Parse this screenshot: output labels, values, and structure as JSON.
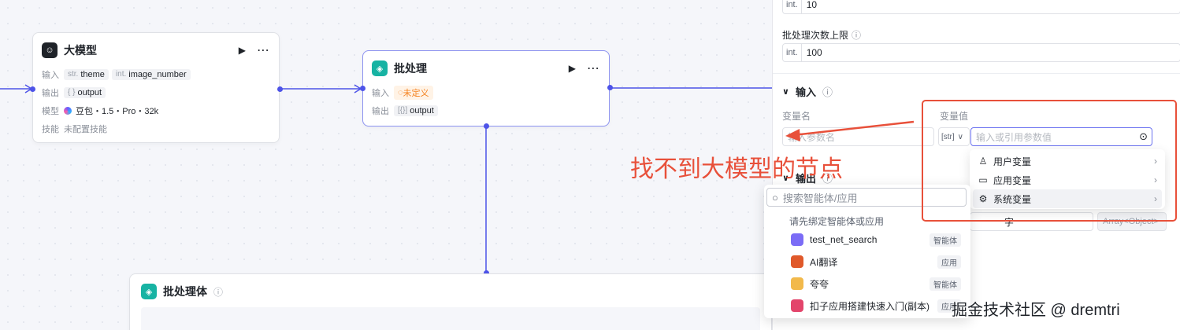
{
  "canvas": {
    "node_llm": {
      "title": "大模型",
      "input_label": "输入",
      "inputs": [
        {
          "type": "str.",
          "name": "theme"
        },
        {
          "type": "int.",
          "name": "image_number"
        }
      ],
      "output_label": "输出",
      "output": {
        "type": "{ }",
        "name": "output"
      },
      "model_label": "模型",
      "model_value": "豆包・1.5・Pro・32k",
      "skill_label": "技能",
      "skill_value": "未配置技能"
    },
    "node_batch": {
      "title": "批处理",
      "input_label": "输入",
      "input_value": "未定义",
      "output_label": "输出",
      "output": {
        "type": "[{}]",
        "name": "output"
      }
    },
    "node_batch_body": {
      "title": "批处理体"
    }
  },
  "panel": {
    "int_prefix": "int.",
    "concurrency_value": "10",
    "max_batch_label": "批处理次数上限",
    "max_batch_value": "100",
    "input_section_title": "输入",
    "var_name_header": "变量名",
    "var_value_header": "变量值",
    "var_name_placeholder": "输入参数名",
    "type_select_value": "[str]",
    "var_value_placeholder": "输入或引用参数值",
    "output_section_title": "输出",
    "hidden_field_fragment": "字",
    "hidden_type_fragment": "Array<Object>"
  },
  "variable_dropdown": {
    "items": [
      {
        "icon": "user-icon",
        "label": "用户变量"
      },
      {
        "icon": "folder-icon",
        "label": "应用变量"
      },
      {
        "icon": "gear-icon",
        "label": "系统变量"
      }
    ]
  },
  "bind_popover": {
    "search_placeholder": "搜索智能体/应用",
    "hint": "请先绑定智能体或应用",
    "items": [
      {
        "name": "test_net_search",
        "badge": "智能体",
        "color": "#7b6cf6"
      },
      {
        "name": "AI翻译",
        "badge": "应用",
        "color": "#e0592a"
      },
      {
        "name": "夸夸",
        "badge": "智能体",
        "color": "#f2b94b"
      },
      {
        "name": "扣子应用搭建快速入门(副本)",
        "badge": "应用",
        "color": "#e3456b"
      }
    ]
  },
  "annotation": {
    "text": "找不到大模型的节点",
    "color": "#e8503a"
  },
  "watermark": "掘金技术社区 @ dremtri"
}
